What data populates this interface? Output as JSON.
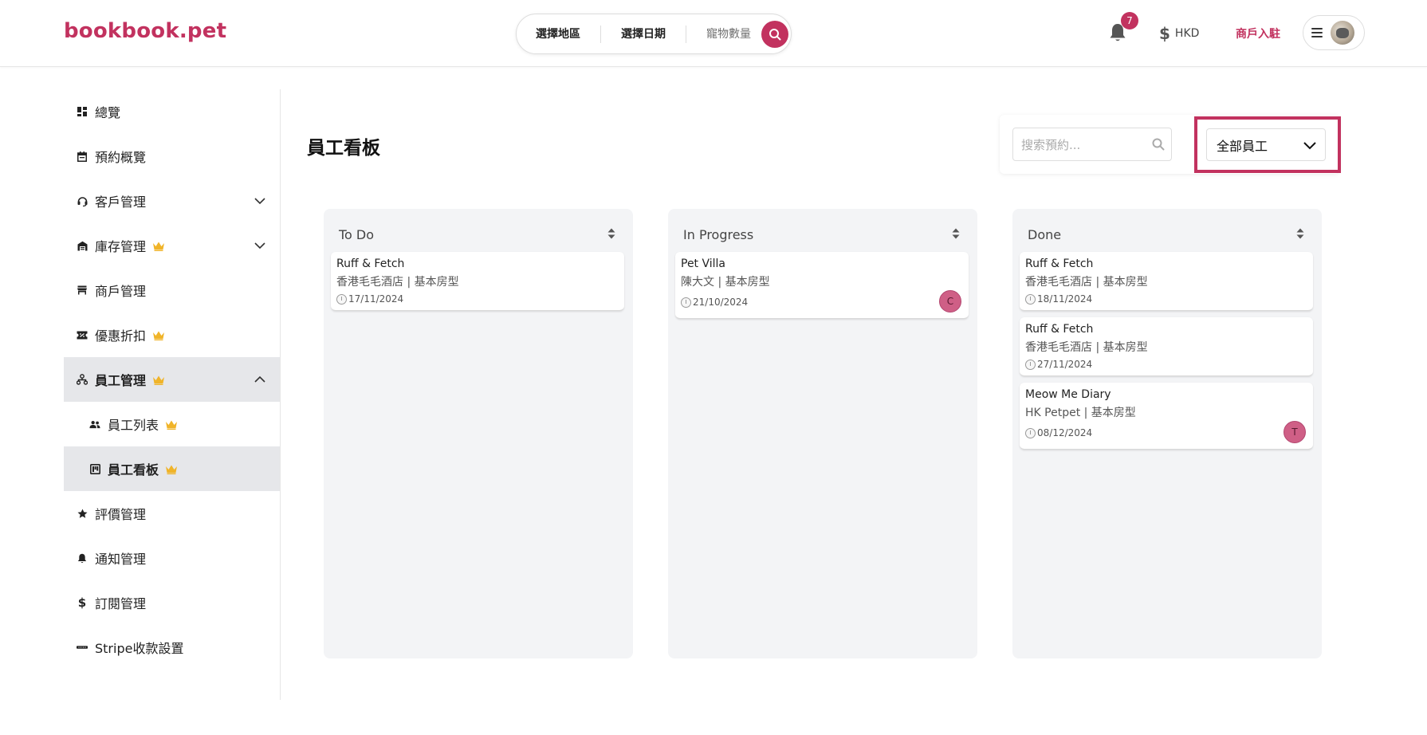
{
  "header": {
    "logo": "bookbook.pet",
    "search": {
      "region": "選擇地區",
      "date": "選擇日期",
      "pets": "寵物數量"
    },
    "notification_count": "7",
    "currency": "HKD",
    "merchant_link": "商戶入駐"
  },
  "sidebar": {
    "items": [
      {
        "label": "總覽",
        "icon": "dashboard-icon"
      },
      {
        "label": "預約概覽",
        "icon": "calendar-icon"
      },
      {
        "label": "客戶管理",
        "icon": "headset-icon",
        "expandable": true
      },
      {
        "label": "庫存管理",
        "icon": "warehouse-icon",
        "premium": true,
        "expandable": true
      },
      {
        "label": "商戶管理",
        "icon": "store-icon"
      },
      {
        "label": "優惠折扣",
        "icon": "coupon-icon",
        "premium": true
      },
      {
        "label": "員工管理",
        "icon": "org-chart-icon",
        "premium": true,
        "expanded": true,
        "active": true
      },
      {
        "label": "員工列表",
        "icon": "people-icon",
        "premium": true,
        "sub": true
      },
      {
        "label": "員工看板",
        "icon": "kanban-icon",
        "premium": true,
        "sub": true,
        "selected": true
      },
      {
        "label": "評價管理",
        "icon": "star-icon"
      },
      {
        "label": "通知管理",
        "icon": "bell-icon"
      },
      {
        "label": "訂閱管理",
        "icon": "dollar-icon"
      },
      {
        "label": "Stripe收款設置",
        "icon": "stripe-icon"
      }
    ]
  },
  "main": {
    "title": "員工看板",
    "search_placeholder": "搜索預約...",
    "staff_filter": "全部員工"
  },
  "board": {
    "columns": [
      {
        "title": "To Do",
        "cards": [
          {
            "name": "Ruff & Fetch",
            "detail": "香港毛毛酒店 | 基本房型",
            "date": "17/11/2024",
            "assignee": ""
          }
        ]
      },
      {
        "title": "In Progress",
        "cards": [
          {
            "name": "Pet Villa",
            "detail": "陳大文 | 基本房型",
            "date": "21/10/2024",
            "assignee": "C"
          }
        ]
      },
      {
        "title": "Done",
        "cards": [
          {
            "name": "Ruff & Fetch",
            "detail": "香港毛毛酒店 | 基本房型",
            "date": "18/11/2024",
            "assignee": ""
          },
          {
            "name": "Ruff & Fetch",
            "detail": "香港毛毛酒店 | 基本房型",
            "date": "27/11/2024",
            "assignee": ""
          },
          {
            "name": "Meow Me Diary",
            "detail": "HK Petpet | 基本房型",
            "date": "08/12/2024",
            "assignee": "T"
          }
        ]
      }
    ]
  },
  "colors": {
    "brand": "#c2325f",
    "crown": "#f0b429",
    "column_bg": "#f3f4f6",
    "active_bg": "#e6e7ea"
  }
}
